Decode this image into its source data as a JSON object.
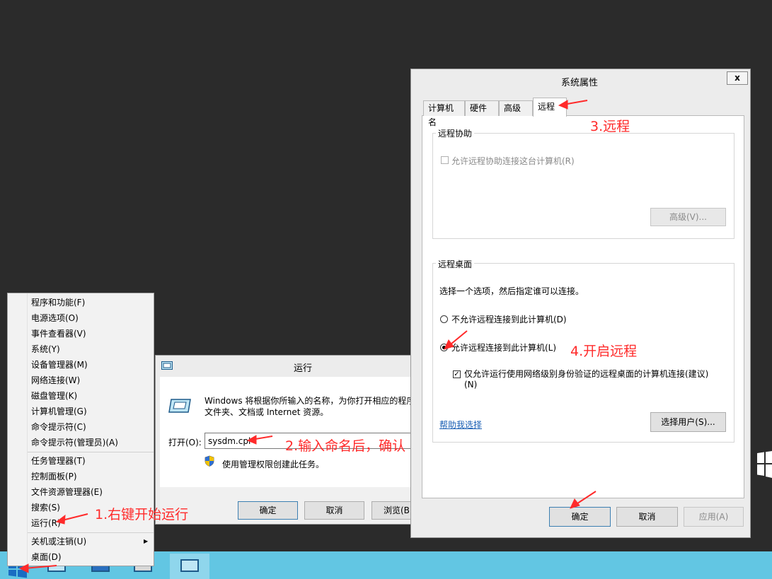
{
  "context_menu": {
    "items": [
      "程序和功能(F)",
      "电源选项(O)",
      "事件查看器(V)",
      "系统(Y)",
      "设备管理器(M)",
      "网络连接(W)",
      "磁盘管理(K)",
      "计算机管理(G)",
      "命令提示符(C)",
      "命令提示符(管理员)(A)",
      "任务管理器(T)",
      "控制面板(P)",
      "文件资源管理器(E)",
      "搜索(S)",
      "运行(R)",
      "关机或注销(U)",
      "桌面(D)"
    ]
  },
  "run_dialog": {
    "title": "运行",
    "description_line1": "Windows 将根据你所输入的名称，为你打开相应的程序",
    "description_line2": "文件夹、文档或 Internet 资源。",
    "open_label": "打开(O):",
    "input_value": "sysdm.cpl",
    "admin_note": "使用管理权限创建此任务。",
    "ok": "确定",
    "cancel": "取消",
    "browse": "浏览(B)"
  },
  "system_properties": {
    "title": "系统属性",
    "close": "x",
    "tabs": [
      "计算机名",
      "硬件",
      "高级",
      "远程"
    ],
    "remote_assistance": {
      "title": "远程协助",
      "allow": "允许远程协助连接这台计算机(R)",
      "advanced": "高级(V)..."
    },
    "remote_desktop": {
      "title": "远程桌面",
      "instruction": "选择一个选项，然后指定谁可以连接。",
      "opt_deny": "不允许远程连接到此计算机(D)",
      "opt_allow": "允许远程连接到此计算机(L)",
      "nla_line1": "仅允许运行使用网络级别身份验证的远程桌面的计算机连接(建议)",
      "nla_line2": "(N)",
      "help": "帮助我选择",
      "select_users": "选择用户(S)..."
    },
    "ok": "确定",
    "cancel": "取消",
    "apply": "应用(A)"
  },
  "annotations": {
    "step1": "1.右键开始运行",
    "step2": "2.输入命名后，确认",
    "step3": "3.远程",
    "step4": "4.开启远程"
  },
  "colors": {
    "desktop": "#2b2b2b",
    "taskbar": "#62c6e3",
    "annotation": "#ff2a2a",
    "link": "#1a5fb4"
  }
}
